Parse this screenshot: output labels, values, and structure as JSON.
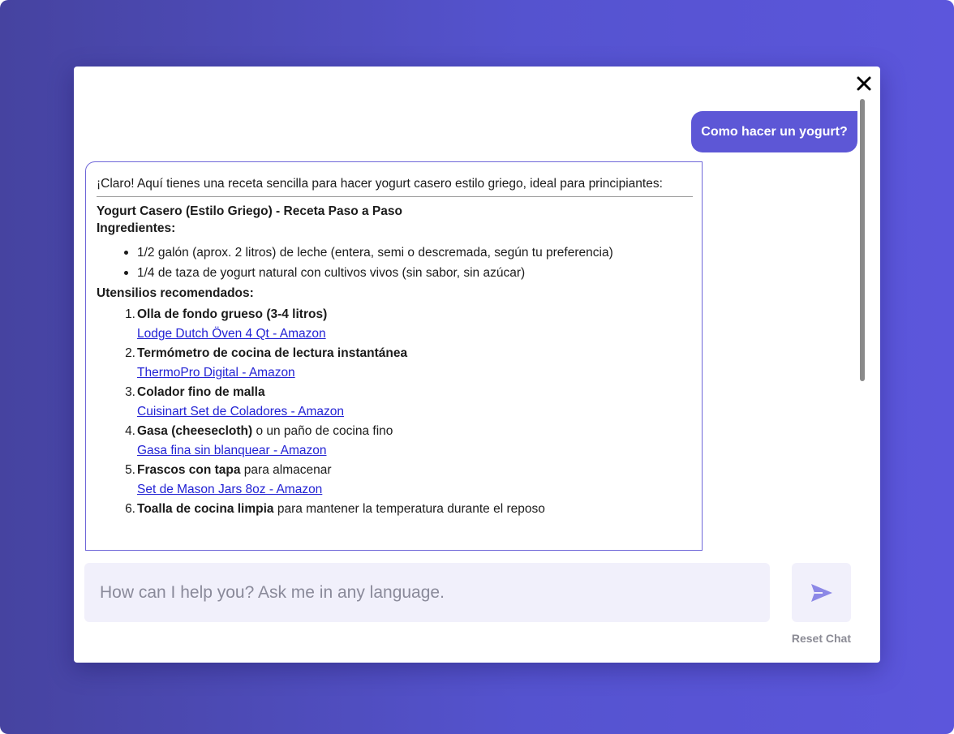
{
  "chat": {
    "user_message": "Como hacer un yogurt?",
    "assistant": {
      "intro": "¡Claro! Aquí tienes una receta sencilla para hacer yogurt casero estilo griego, ideal para principiantes:",
      "recipe_title": "Yogurt Casero (Estilo Griego) - Receta Paso a Paso",
      "ingredients_heading": "Ingredientes:",
      "ingredients": [
        "1/2 galón (aprox. 2 litros) de leche (entera, semi o descremada, según tu preferencia)",
        "1/4 de taza de yogurt natural con cultivos vivos (sin sabor, sin azúcar)"
      ],
      "tools_heading": "Utensilios recomendados:",
      "tools": [
        {
          "number": "1.",
          "name": "Olla de fondo grueso (3-4 litros)",
          "rest": "",
          "link": "Lodge Dutch Öven 4 Qt - Amazon"
        },
        {
          "number": "2.",
          "name": "Termómetro de cocina de lectura instantánea",
          "rest": "",
          "link": "ThermoPro Digital - Amazon"
        },
        {
          "number": "3.",
          "name": "Colador fino de malla",
          "rest": "",
          "link": "Cuisinart Set de Coladores - Amazon"
        },
        {
          "number": "4.",
          "name": "Gasa (cheesecloth)",
          "rest": " o un paño de cocina fino",
          "link": "Gasa fina sin blanquear - Amazon"
        },
        {
          "number": "5.",
          "name": "Frascos con tapa",
          "rest": " para almacenar",
          "link": "Set de Mason Jars 8oz - Amazon"
        },
        {
          "number": "6.",
          "name": "Toalla de cocina limpia",
          "rest": " para mantener la temperatura durante el reposo",
          "link": ""
        }
      ]
    }
  },
  "composer": {
    "placeholder": "How can I help you? Ask me in any language.",
    "send_icon": "send-icon",
    "reset_label": "Reset Chat"
  },
  "icons": {
    "close": "close-icon"
  },
  "colors": {
    "accent": "#5d57d6",
    "link": "#2323d4",
    "input_bg": "#f1f0fb"
  }
}
